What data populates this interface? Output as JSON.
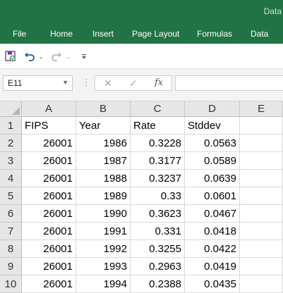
{
  "app": {
    "title_fragment": "Data"
  },
  "ribbon": {
    "tabs": [
      "File",
      "Home",
      "Insert",
      "Page Layout",
      "Formulas",
      "Data"
    ]
  },
  "qat": {
    "icons": [
      "save-icon",
      "undo-icon",
      "undo-dropdown-icon",
      "redo-icon",
      "redo-dropdown-icon",
      "customize-qat-icon"
    ]
  },
  "formula_bar": {
    "name_box": "E11",
    "cancel_symbol": "✕",
    "enter_symbol": "✓",
    "fx_symbol": "fx",
    "formula": ""
  },
  "sheet": {
    "columns": [
      "A",
      "B",
      "C",
      "D",
      "E"
    ],
    "rows": [
      {
        "num": "1",
        "cells": [
          "FIPS",
          "Year",
          "Rate",
          "Stddev",
          ""
        ]
      },
      {
        "num": "2",
        "cells": [
          "26001",
          "1986",
          "0.3228",
          "0.0563",
          ""
        ]
      },
      {
        "num": "3",
        "cells": [
          "26001",
          "1987",
          "0.3177",
          "0.0589",
          ""
        ]
      },
      {
        "num": "4",
        "cells": [
          "26001",
          "1988",
          "0.3237",
          "0.0639",
          ""
        ]
      },
      {
        "num": "5",
        "cells": [
          "26001",
          "1989",
          "0.33",
          "0.0601",
          ""
        ]
      },
      {
        "num": "6",
        "cells": [
          "26001",
          "1990",
          "0.3623",
          "0.0467",
          ""
        ]
      },
      {
        "num": "7",
        "cells": [
          "26001",
          "1991",
          "0.331",
          "0.0418",
          ""
        ]
      },
      {
        "num": "8",
        "cells": [
          "26001",
          "1992",
          "0.3255",
          "0.0422",
          ""
        ]
      },
      {
        "num": "9",
        "cells": [
          "26001",
          "1993",
          "0.2963",
          "0.0419",
          ""
        ]
      },
      {
        "num": "10",
        "cells": [
          "26001",
          "1994",
          "0.2388",
          "0.0435",
          ""
        ]
      }
    ]
  },
  "colors": {
    "ribbon": "#217346",
    "header_bg": "#e6e6e6",
    "gridline": "#d8d8d8"
  }
}
